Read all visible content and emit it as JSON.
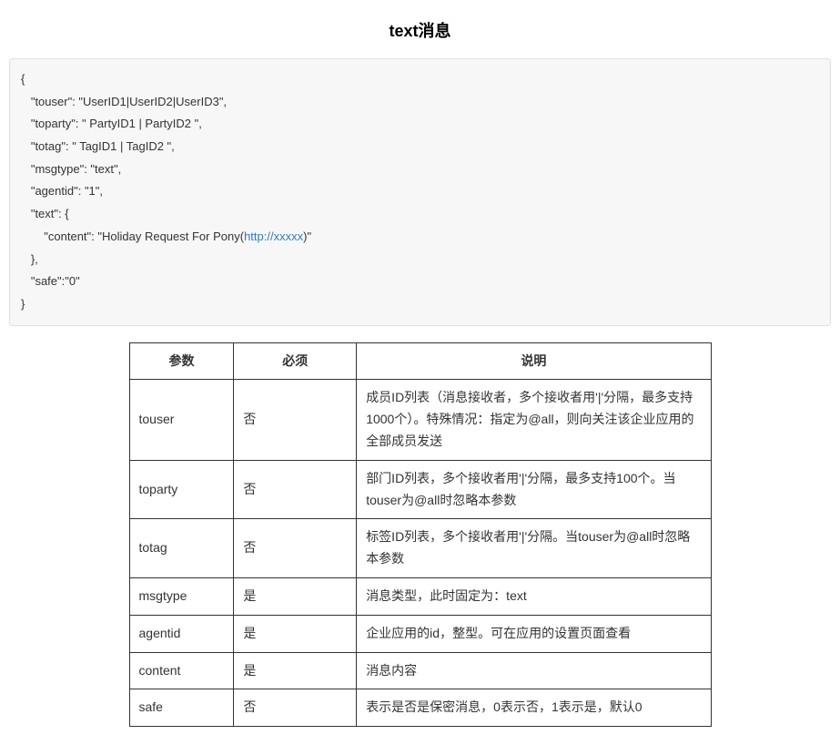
{
  "title": "text消息",
  "code": {
    "l1": "{",
    "l2": "   \"touser\": \"UserID1|UserID2|UserID3\",",
    "l3": "   \"toparty\": \" PartyID1 | PartyID2 \",",
    "l4": "   \"totag\": \" TagID1 | TagID2 \",",
    "l5": "   \"msgtype\": \"text\",",
    "l6": "   \"agentid\": \"1\",",
    "l7": "   \"text\": {",
    "l8a": "       \"content\": \"Holiday Request For Pony(",
    "link_text": "http://xxxxx",
    "l8b": ")\"",
    "l9": "   },",
    "l10": "   \"safe\":\"0\"",
    "l11": "}"
  },
  "table": {
    "headers": {
      "param": "参数",
      "required": "必须",
      "desc": "说明"
    },
    "rows": [
      {
        "param": "touser",
        "required": "否",
        "desc": "成员ID列表（消息接收者，多个接收者用'|'分隔，最多支持1000个）。特殊情况：指定为@all，则向关注该企业应用的全部成员发送"
      },
      {
        "param": "toparty",
        "required": "否",
        "desc": "部门ID列表，多个接收者用'|'分隔，最多支持100个。当touser为@all时忽略本参数"
      },
      {
        "param": "totag",
        "required": "否",
        "desc": "标签ID列表，多个接收者用'|'分隔。当touser为@all时忽略本参数"
      },
      {
        "param": "msgtype",
        "required": "是",
        "desc": "消息类型，此时固定为：text"
      },
      {
        "param": "agentid",
        "required": "是",
        "desc": "企业应用的id，整型。可在应用的设置页面查看"
      },
      {
        "param": "content",
        "required": "是",
        "desc": "消息内容"
      },
      {
        "param": "safe",
        "required": "否",
        "desc": "表示是否是保密消息，0表示否，1表示是，默认0"
      }
    ]
  }
}
